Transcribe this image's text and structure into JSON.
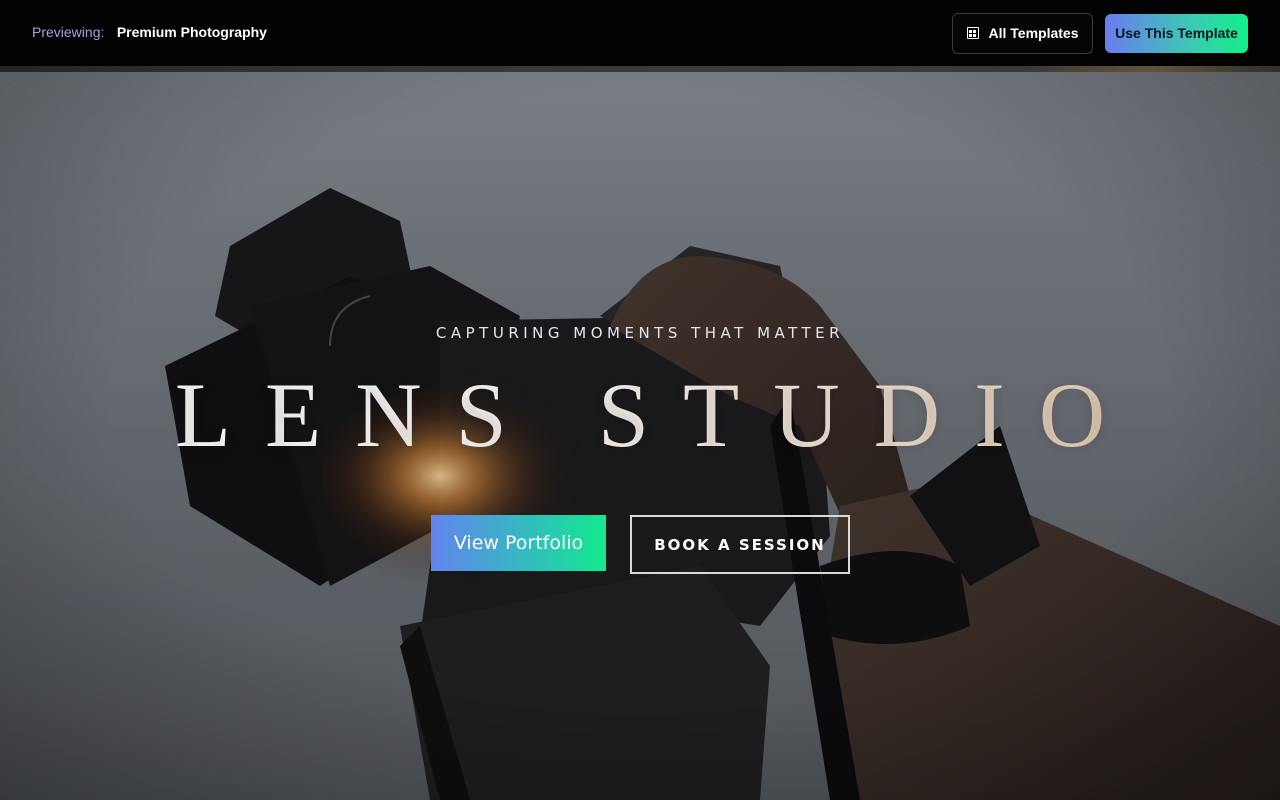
{
  "topbar": {
    "preview_label": "Previewing:",
    "template_name": "Premium Photography",
    "all_templates_label": "All Templates",
    "use_template_label": "Use This Template"
  },
  "hero": {
    "tagline": "CAPTURING MOMENTS THAT MATTER",
    "brand": "LENS STUDIO",
    "primary_cta": "View Portfolio",
    "secondary_cta": "BOOK A SESSION"
  },
  "colors": {
    "accent_start": "#6383ee",
    "accent_end": "#12ea8c",
    "topbar_bg": "#020203",
    "preview_label": "#a7a3d8"
  },
  "icons": {
    "all_templates": "grid-icon"
  }
}
